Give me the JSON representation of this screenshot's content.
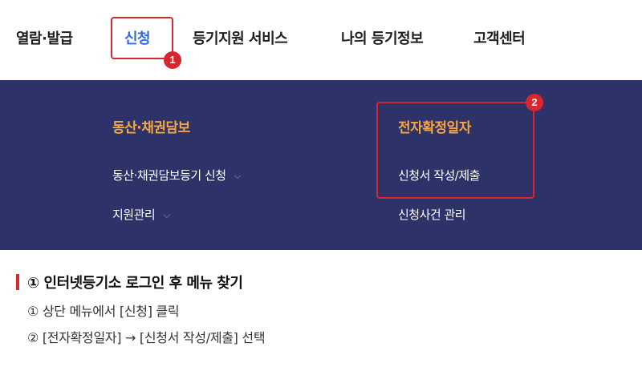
{
  "nav": {
    "items": [
      {
        "label": "열람·발급"
      },
      {
        "label": "신청"
      },
      {
        "label": "등기지원 서비스"
      },
      {
        "label": "나의 등기정보"
      },
      {
        "label": "고객센터"
      }
    ]
  },
  "badges": {
    "first": "1",
    "second": "2"
  },
  "mega": {
    "left": {
      "heading": "동산·채권담보",
      "links": [
        {
          "label": "동산·채권담보등기 신청",
          "icon": "chevron-down-icon"
        },
        {
          "label": "지원관리",
          "icon": "chevron-down-icon"
        }
      ]
    },
    "right": {
      "heading": "전자확정일자",
      "links": [
        {
          "label": "신청서 작성/제출"
        },
        {
          "label": "신청사건 관리"
        }
      ]
    }
  },
  "guide": {
    "title": "① 인터넷등기소 로그인 후 메뉴 찾기",
    "steps": [
      "① 상단 메뉴에서 [신청] 클릭",
      "② [전자확정일자] → [신청서 작성/제출] 선택"
    ]
  },
  "colors": {
    "accent_red": "#d8262f",
    "active_blue": "#2d6be0",
    "menu_bg": "#2d3368",
    "menu_heading": "#f5a742"
  }
}
